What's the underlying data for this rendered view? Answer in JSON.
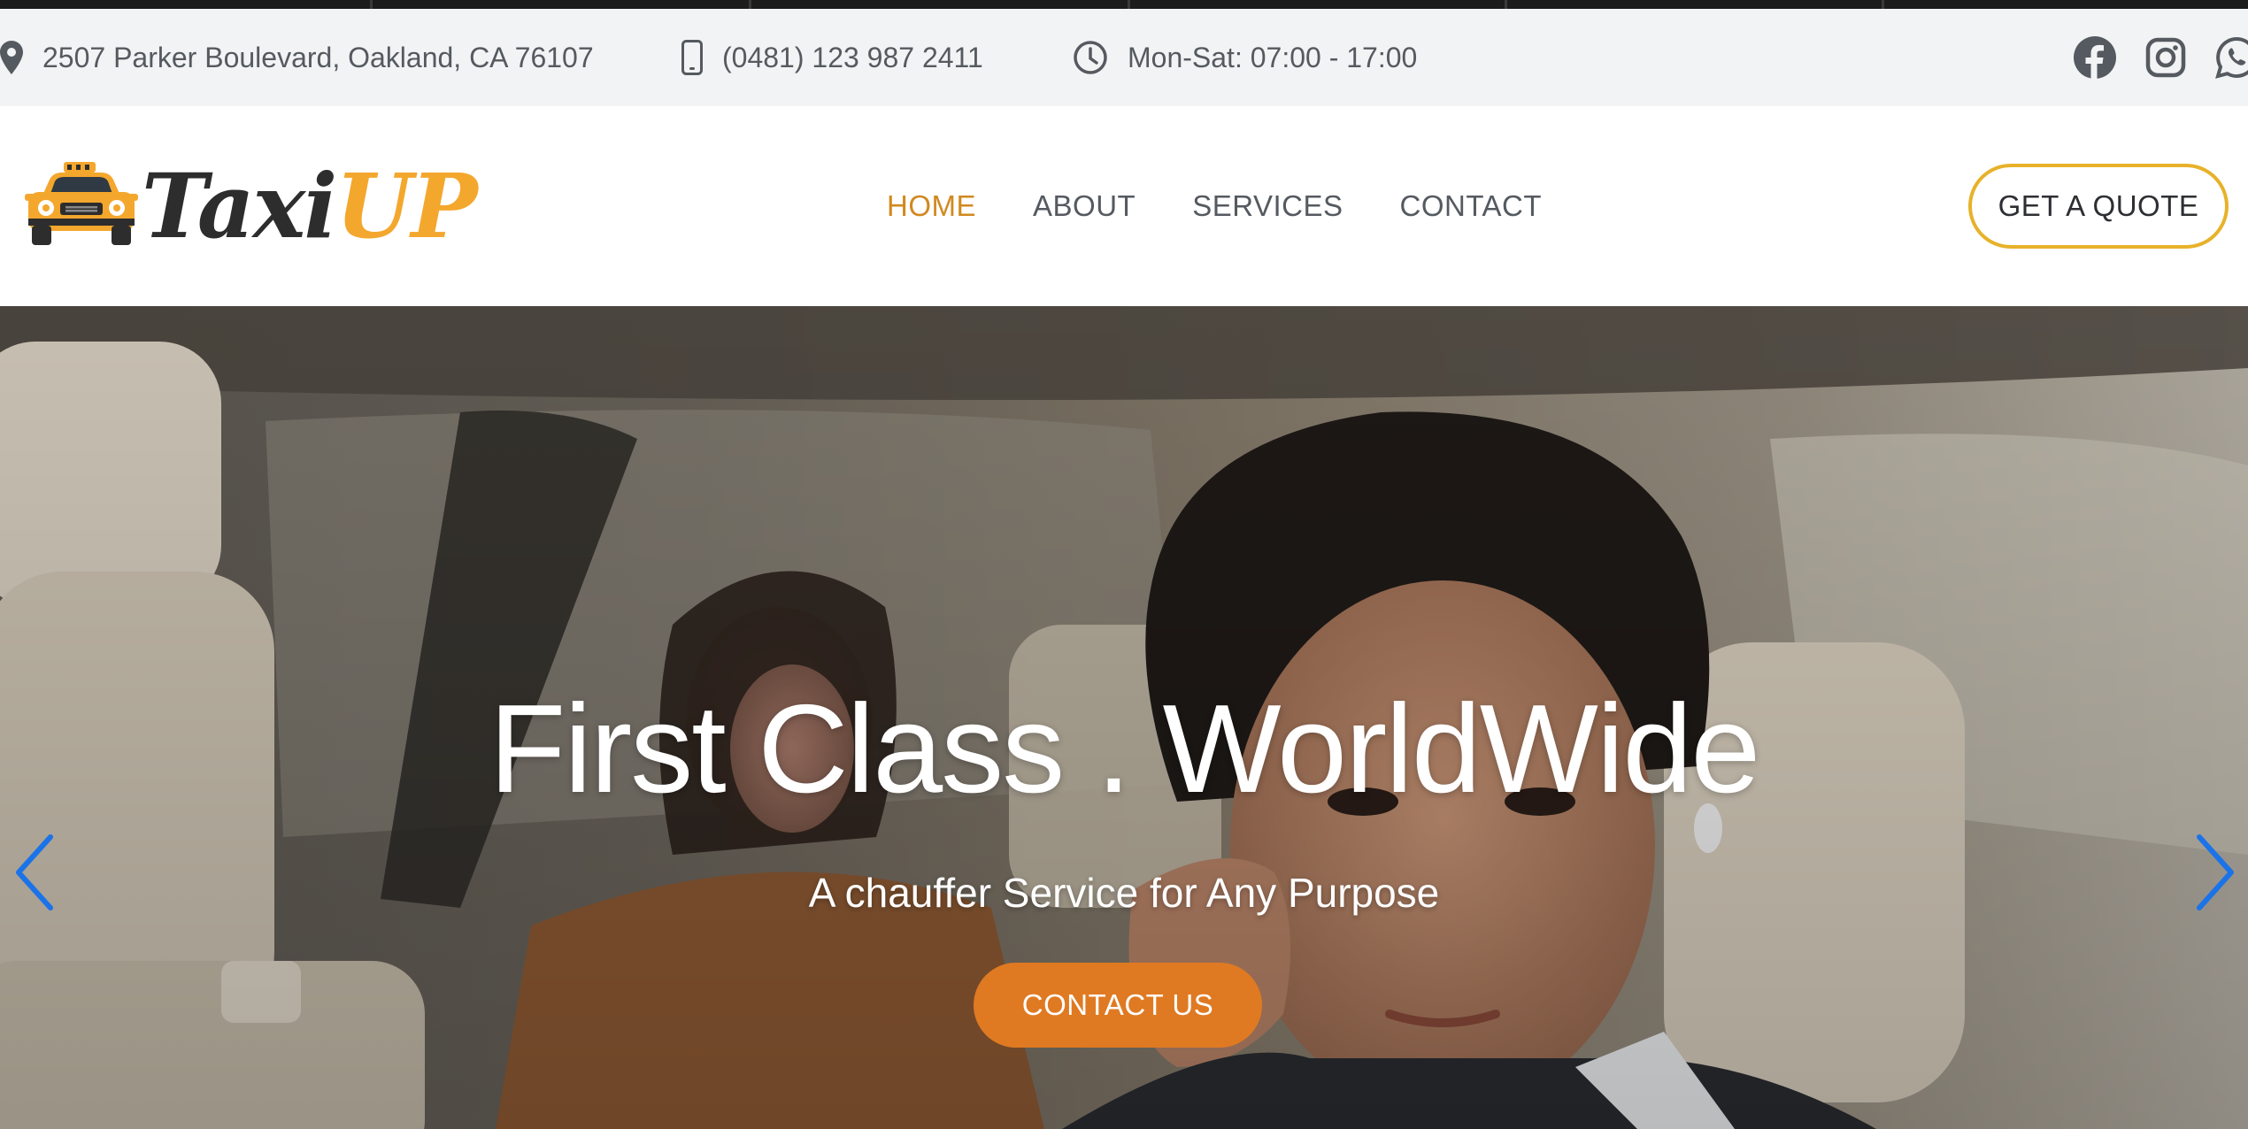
{
  "topbar": {
    "address": "2507 Parker Boulevard, Oakland, CA 76107",
    "phone": "(0481) 123 987 2411",
    "hours": "Mon-Sat: 07:00 - 17:00",
    "icons": {
      "address": "map-pin-icon",
      "phone": "mobile-phone-icon",
      "hours": "clock-icon"
    },
    "social": [
      "facebook-icon",
      "instagram-icon",
      "whatsapp-icon"
    ]
  },
  "header": {
    "logo": {
      "part1": "Taxi",
      "part2": "UP",
      "icon": "taxi-car-icon"
    },
    "nav": [
      {
        "label": "HOME",
        "active": true
      },
      {
        "label": "ABOUT",
        "active": false
      },
      {
        "label": "SERVICES",
        "active": false
      },
      {
        "label": "CONTACT",
        "active": false
      }
    ],
    "cta_label": "GET A QUOTE"
  },
  "hero": {
    "title": "First Class . WorldWide",
    "subtitle": "A chauffer Service for Any Purpose",
    "button_label": "CONTACT US",
    "prev_icon": "chevron-left-icon",
    "next_icon": "chevron-right-icon"
  },
  "colors": {
    "accent_orange": "#df7a22",
    "nav_active": "#d1891f",
    "logo_yellow": "#f4a72d",
    "quote_border": "#e7b22a",
    "carousel_arrow": "#1a73e8",
    "topbar_bg": "#f2f3f4",
    "text_gray": "#555a60"
  }
}
